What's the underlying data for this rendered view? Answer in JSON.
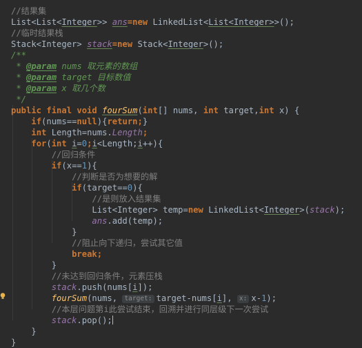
{
  "editor": {
    "colors": {
      "background": "#2b2b2b",
      "default": "#a9b7c6",
      "keyword": "#cc7832",
      "comment": "#808080",
      "doc_comment": "#629755",
      "doc_tag": "#629755",
      "field": "#9876aa",
      "method": "#ffc66d",
      "number": "#6897bb",
      "generic": "#507874",
      "param": "#cc7832"
    },
    "lines": [
      [
        {
          "t": "//结果集",
          "c": "comment"
        }
      ],
      [
        {
          "t": "List<List<",
          "c": "default"
        },
        {
          "t": "Integer",
          "c": "default",
          "u": 1
        },
        {
          "t": ">> ",
          "c": "default"
        },
        {
          "t": "ans",
          "c": "field",
          "u": 1
        },
        {
          "t": "=new ",
          "c": "keyword"
        },
        {
          "t": "LinkedList<",
          "c": "default"
        },
        {
          "t": "List<Integer>",
          "c": "default",
          "u": 1
        },
        {
          "t": ">();",
          "c": "default"
        }
      ],
      [
        {
          "t": "//临时结果栈",
          "c": "comment"
        }
      ],
      [
        {
          "t": "Stack<Integer> ",
          "c": "default"
        },
        {
          "t": "stack",
          "c": "field",
          "u": 1
        },
        {
          "t": "=new ",
          "c": "keyword"
        },
        {
          "t": "Stack<",
          "c": "default"
        },
        {
          "t": "Integer",
          "c": "default",
          "u": 1
        },
        {
          "t": ">();",
          "c": "default"
        }
      ],
      [
        {
          "t": "/**",
          "c": "doc_comment"
        }
      ],
      [
        {
          "t": " * ",
          "c": "doc_comment"
        },
        {
          "t": "@param",
          "c": "doc_tag",
          "u": 1
        },
        {
          "t": " nums ",
          "c": "doc_comment"
        },
        {
          "t": "取元素的数组",
          "c": "doc_comment"
        }
      ],
      [
        {
          "t": " * ",
          "c": "doc_comment"
        },
        {
          "t": "@param",
          "c": "doc_tag",
          "u": 1
        },
        {
          "t": " target ",
          "c": "doc_comment"
        },
        {
          "t": "目标数值",
          "c": "doc_comment"
        }
      ],
      [
        {
          "t": " * ",
          "c": "doc_comment"
        },
        {
          "t": "@param",
          "c": "doc_tag",
          "u": 1
        },
        {
          "t": " x ",
          "c": "doc_comment"
        },
        {
          "t": "取几个数",
          "c": "doc_comment"
        }
      ],
      [
        {
          "t": " */",
          "c": "doc_comment"
        }
      ],
      [
        {
          "t": "public final void ",
          "c": "keyword"
        },
        {
          "t": "fourSum",
          "c": "method",
          "u": 1
        },
        {
          "t": "(",
          "c": "default"
        },
        {
          "t": "int",
          "c": "keyword"
        },
        {
          "t": "[] nums, ",
          "c": "default"
        },
        {
          "t": "int ",
          "c": "keyword"
        },
        {
          "t": "target,",
          "c": "default"
        },
        {
          "t": "int ",
          "c": "keyword"
        },
        {
          "t": "x) {",
          "c": "default"
        }
      ],
      [
        {
          "t": "    ",
          "c": "default"
        },
        {
          "t": "if",
          "c": "keyword"
        },
        {
          "t": "(nums==",
          "c": "default"
        },
        {
          "t": "null",
          "c": "keyword"
        },
        {
          "t": "){",
          "c": "default"
        },
        {
          "t": "return;",
          "c": "keyword"
        },
        {
          "t": "}",
          "c": "default"
        }
      ],
      [
        {
          "t": "    ",
          "c": "default"
        },
        {
          "t": "int ",
          "c": "keyword"
        },
        {
          "t": "Length=nums.",
          "c": "default"
        },
        {
          "t": "Length",
          "c": "field"
        },
        {
          "t": ";",
          "c": "keyword"
        }
      ],
      [
        {
          "t": "    ",
          "c": "default"
        },
        {
          "t": "for",
          "c": "keyword"
        },
        {
          "t": "(",
          "c": "default"
        },
        {
          "t": "int ",
          "c": "keyword"
        },
        {
          "t": "i",
          "c": "default",
          "u": 1
        },
        {
          "t": "=",
          "c": "default"
        },
        {
          "t": "0",
          "c": "number"
        },
        {
          "t": ";",
          "c": "keyword"
        },
        {
          "t": "i",
          "c": "default",
          "u": 1
        },
        {
          "t": "<Length;",
          "c": "default"
        },
        {
          "t": "i",
          "c": "default",
          "u": 1
        },
        {
          "t": "++){",
          "c": "default"
        }
      ],
      [
        {
          "t": "        ",
          "c": "default"
        },
        {
          "t": "//回归条件",
          "c": "comment"
        }
      ],
      [
        {
          "t": "        ",
          "c": "default"
        },
        {
          "t": "if",
          "c": "keyword"
        },
        {
          "t": "(x==",
          "c": "default"
        },
        {
          "t": "1",
          "c": "number"
        },
        {
          "t": "){",
          "c": "default"
        }
      ],
      [
        {
          "t": "            ",
          "c": "default"
        },
        {
          "t": "//判断是否为想要的解",
          "c": "comment"
        }
      ],
      [
        {
          "t": "            ",
          "c": "default"
        },
        {
          "t": "if",
          "c": "keyword"
        },
        {
          "t": "(target==",
          "c": "default"
        },
        {
          "t": "0",
          "c": "number"
        },
        {
          "t": "){",
          "c": "default"
        }
      ],
      [
        {
          "t": "                ",
          "c": "default"
        },
        {
          "t": "//是则放入结果集",
          "c": "comment"
        }
      ],
      [
        {
          "t": "                ",
          "c": "default"
        },
        {
          "t": "List<Integer> ",
          "c": "default"
        },
        {
          "t": "temp=",
          "c": "default"
        },
        {
          "t": "new ",
          "c": "keyword"
        },
        {
          "t": "LinkedList<",
          "c": "default"
        },
        {
          "t": "Integer",
          "c": "default",
          "u": 1
        },
        {
          "t": ">(",
          "c": "default"
        },
        {
          "t": "stack",
          "c": "field"
        },
        {
          "t": ");",
          "c": "default"
        }
      ],
      [
        {
          "t": "                ",
          "c": "default"
        },
        {
          "t": "ans",
          "c": "field"
        },
        {
          "t": ".add(temp);",
          "c": "default"
        }
      ],
      [
        {
          "t": "            ",
          "c": "default"
        },
        {
          "t": "}",
          "c": "default"
        }
      ],
      [
        {
          "t": "            ",
          "c": "default"
        },
        {
          "t": "//阻止向下递归，尝试其它值",
          "c": "comment"
        }
      ],
      [
        {
          "t": "            ",
          "c": "default"
        },
        {
          "t": "break;",
          "c": "keyword"
        }
      ],
      [
        {
          "t": "        ",
          "c": "default"
        },
        {
          "t": "}",
          "c": "default"
        }
      ],
      [
        {
          "t": "        ",
          "c": "default"
        },
        {
          "t": "//未达到回归条件，元素压栈",
          "c": "comment"
        }
      ],
      [
        {
          "t": "        ",
          "c": "default"
        },
        {
          "t": "stack",
          "c": "field"
        },
        {
          "t": ".push(nums[",
          "c": "default"
        },
        {
          "t": "i",
          "c": "default",
          "u": 1
        },
        {
          "t": "]);",
          "c": "default"
        }
      ],
      [
        {
          "t": "        ",
          "c": "default"
        },
        {
          "t": "fourSum",
          "c": "method"
        },
        {
          "t": "(nums, ",
          "c": "default"
        },
        {
          "h": "target:"
        },
        {
          "t": "target-nums[",
          "c": "default"
        },
        {
          "t": "i",
          "c": "default",
          "u": 1
        },
        {
          "t": "], ",
          "c": "default"
        },
        {
          "h": "x:"
        },
        {
          "t": "x-",
          "c": "default"
        },
        {
          "t": "1",
          "c": "number"
        },
        {
          "t": ");",
          "c": "default"
        }
      ],
      [
        {
          "t": "        ",
          "c": "default"
        },
        {
          "t": "//本层问题第i此尝试结束，回溯并进行同层级下一次尝试",
          "c": "comment"
        }
      ],
      [
        {
          "t": "        ",
          "c": "default"
        },
        {
          "t": "stack",
          "c": "field"
        },
        {
          "t": ".pop();",
          "c": "default"
        },
        {
          "caret": 1
        }
      ],
      [
        {
          "t": "    ",
          "c": "default"
        },
        {
          "t": "}",
          "c": "default"
        }
      ],
      [
        {
          "t": "}",
          "c": "default"
        }
      ]
    ]
  },
  "gutter": {
    "intention_icon": "lightbulb-icon"
  }
}
